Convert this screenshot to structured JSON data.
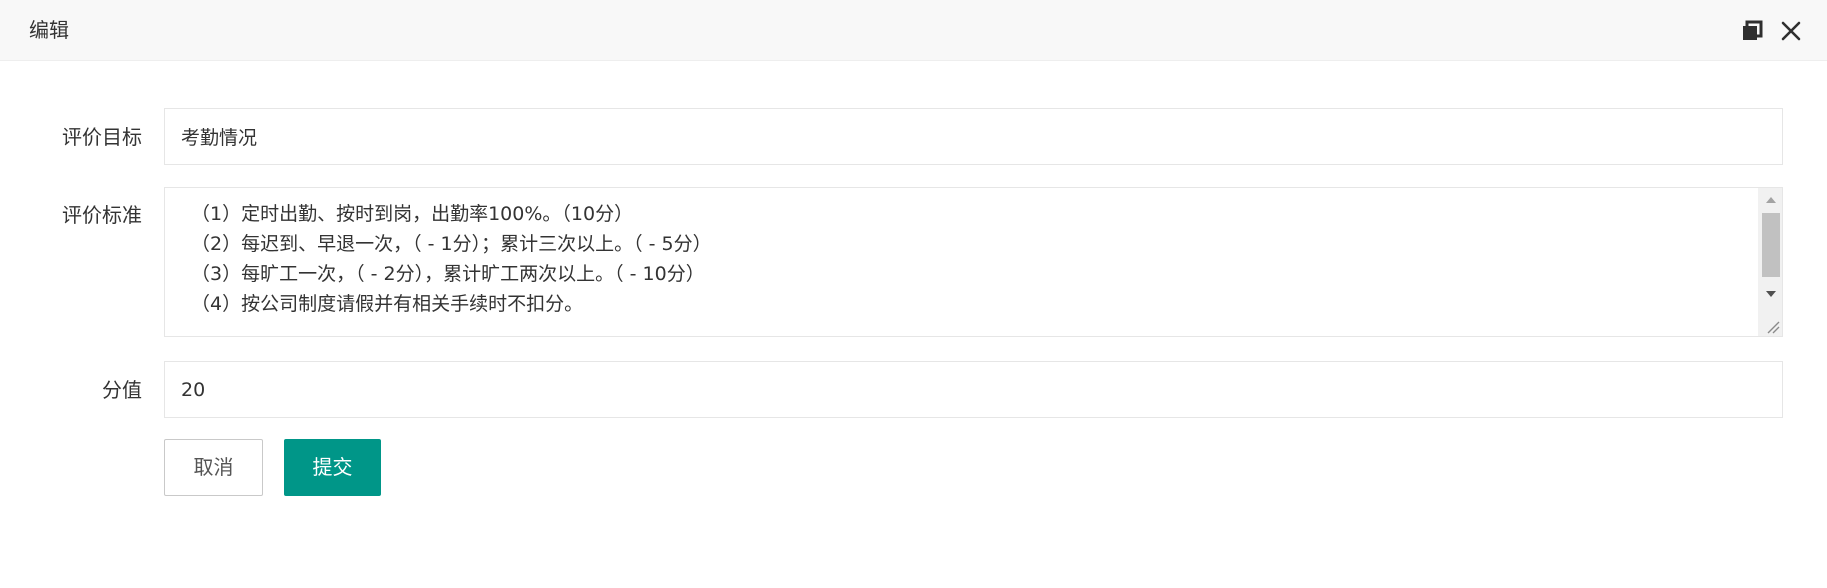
{
  "dialog": {
    "title": "编辑",
    "maximize_icon": "maximize-icon",
    "close_icon": "close-icon"
  },
  "form": {
    "target": {
      "label": "评价目标",
      "value": "考勤情况"
    },
    "standard": {
      "label": "评价标准",
      "lines": [
        "（1）定时出勤、按时到岗，出勤率100%。（10分）",
        "（2）每迟到、早退一次，（ - 1分）；累计三次以上。（ - 5分）",
        "（3）每旷工一次，（ - 2分），累计旷工两次以上。（ - 10分）",
        "（4）按公司制度请假并有相关手续时不扣分。"
      ]
    },
    "score": {
      "label": "分值",
      "value": "20"
    }
  },
  "buttons": {
    "cancel": "取消",
    "submit": "提交"
  },
  "colors": {
    "primary": "#009688",
    "titlebar_bg": "#f8f8f8",
    "border": "#e6e6e6"
  }
}
